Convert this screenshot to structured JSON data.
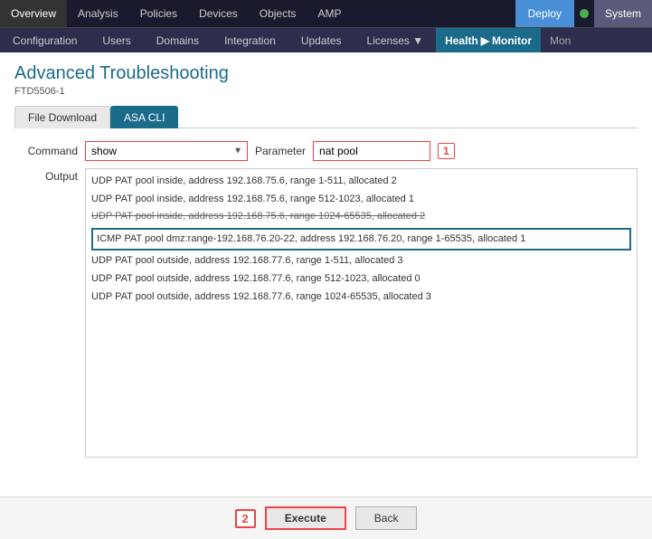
{
  "topNav": {
    "items": [
      {
        "label": "Overview",
        "active": false
      },
      {
        "label": "Analysis",
        "active": false
      },
      {
        "label": "Policies",
        "active": false
      },
      {
        "label": "Devices",
        "active": false
      },
      {
        "label": "Objects",
        "active": false
      },
      {
        "label": "AMP",
        "active": false
      }
    ],
    "deploy_label": "Deploy",
    "system_label": "System"
  },
  "secondNav": {
    "items": [
      {
        "label": "Configuration"
      },
      {
        "label": "Users"
      },
      {
        "label": "Domains"
      },
      {
        "label": "Integration"
      },
      {
        "label": "Updates"
      },
      {
        "label": "Licenses ▼"
      }
    ],
    "health_label": "Health",
    "arrow": "▶",
    "monitor_label": "Monitor",
    "mon_label": "Mon"
  },
  "page": {
    "title": "Advanced Troubleshooting",
    "subtitle": "FTD5506-1"
  },
  "tabs": [
    {
      "label": "File Download",
      "active": false
    },
    {
      "label": "ASA CLI",
      "active": true
    }
  ],
  "form": {
    "command_label": "Command",
    "command_value": "show",
    "param_label": "Parameter",
    "param_value": "nat pool",
    "badge": "1"
  },
  "output": {
    "label": "Output",
    "lines": [
      {
        "text": "UDP PAT pool inside, address 192.168.75.6, range 1-511, allocated 2",
        "highlighted": false,
        "strikethrough": false
      },
      {
        "text": "UDP PAT pool inside, address 192.168.75.6, range 512-1023, allocated 1",
        "highlighted": false,
        "strikethrough": false
      },
      {
        "text": "UDP PAT pool inside, address 192.168.75.6, range 1024-65535, allocated 2",
        "highlighted": false,
        "strikethrough": true
      },
      {
        "text": "ICMP PAT pool dmz:range-192.168.76.20-22, address 192.168.76.20, range 1-65535, allocated 1",
        "highlighted": true,
        "strikethrough": false
      },
      {
        "text": "UDP PAT pool outside, address 192.168.77.6, range 1-511, allocated 3",
        "highlighted": false,
        "strikethrough": false
      },
      {
        "text": "UDP PAT pool outside, address 192.168.77.6, range 512-1023, allocated 0",
        "highlighted": false,
        "strikethrough": false
      },
      {
        "text": "UDP PAT pool outside, address 192.168.77.6, range 1024-65535, allocated 3",
        "highlighted": false,
        "strikethrough": false
      }
    ]
  },
  "buttons": {
    "badge": "2",
    "execute_label": "Execute",
    "back_label": "Back"
  }
}
